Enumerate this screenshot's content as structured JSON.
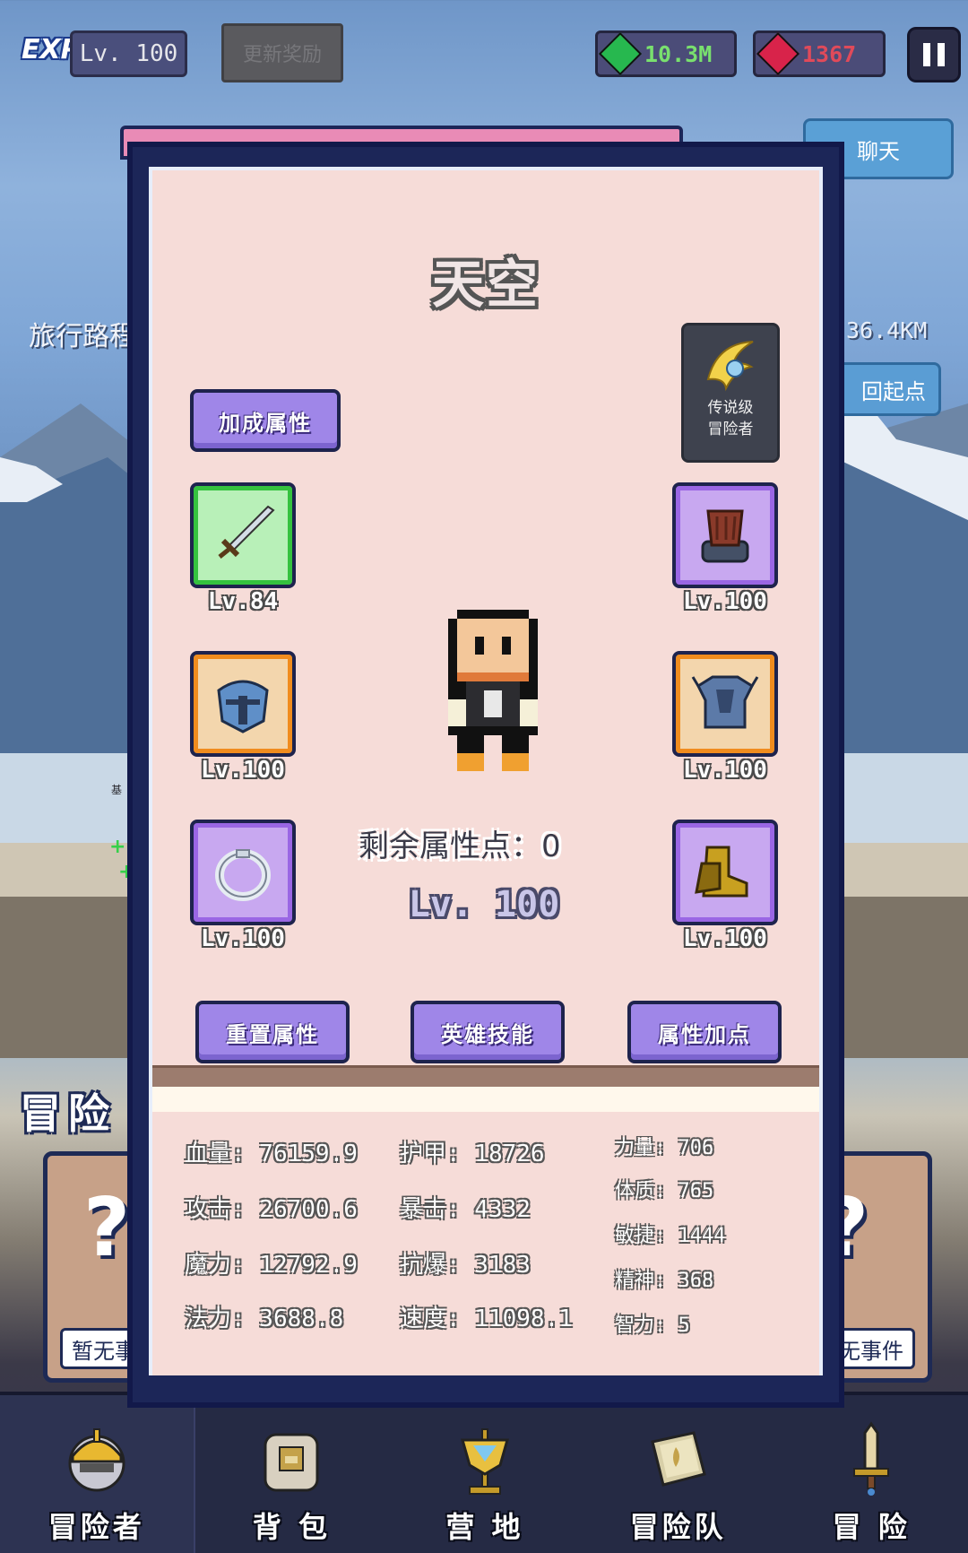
{
  "top_bar": {
    "exp_badge": "EXP",
    "level": "Lv. 100",
    "reward_button": "更新奖励",
    "gems": "10.3M",
    "rubies": "1367"
  },
  "background": {
    "chat": "聊天",
    "travel_label": "旅行路程",
    "travel_distance": "36.4KM",
    "return_button": "回起点",
    "adventure_title": "冒险",
    "left_card_label": "暂无事件",
    "right_card_label": "暂无事件"
  },
  "hero": {
    "name": "天空",
    "rank_line1": "传说级",
    "rank_line2": "冒险者",
    "bonus_button": "加成属性",
    "remaining_points": "剩余属性点：0",
    "level": "Lv. 100",
    "reset_button": "重置属性",
    "skill_button": "英雄技能",
    "add_points_button": "属性加点"
  },
  "equipment": {
    "weapon": {
      "level": "Lv.84",
      "icon": "sword-icon",
      "rarity": "green"
    },
    "helmet": {
      "level": "Lv.100",
      "icon": "helmet-icon",
      "rarity": "orange"
    },
    "ring": {
      "level": "Lv.100",
      "icon": "ring-icon",
      "rarity": "purple"
    },
    "gloves": {
      "level": "Lv.100",
      "icon": "glove-icon",
      "rarity": "purple"
    },
    "armor": {
      "level": "Lv.100",
      "icon": "armor-icon",
      "rarity": "orange"
    },
    "boots": {
      "level": "Lv.100",
      "icon": "boots-icon",
      "rarity": "purple"
    }
  },
  "stats": {
    "col1": [
      "血量: 76159.9",
      "攻击: 26700.6",
      "魔力: 12792.9",
      "法力: 3688.8"
    ],
    "col2": [
      "护甲: 18726",
      "暴击: 4332",
      "抗爆: 3183",
      "速度: 11098.1"
    ],
    "col3": [
      "力量: 706",
      "体质: 765",
      "敏捷: 1444",
      "精神: 368",
      "智力: 5"
    ]
  },
  "nav": [
    {
      "label": "冒险者",
      "icon": "knight-helmet-icon"
    },
    {
      "label": "背 包",
      "icon": "backpack-icon"
    },
    {
      "label": "营 地",
      "icon": "camp-banner-icon"
    },
    {
      "label": "冒险队",
      "icon": "guild-book-icon"
    },
    {
      "label": "冒 险",
      "icon": "sword-icon"
    }
  ],
  "colors": {
    "modal_frame": "#1c2658",
    "modal_panel": "#f6dcd8",
    "button_purple": "#9f86e8",
    "rarity_green": "#35c23f",
    "rarity_purple": "#9a66e4",
    "rarity_orange": "#f08c1e"
  }
}
